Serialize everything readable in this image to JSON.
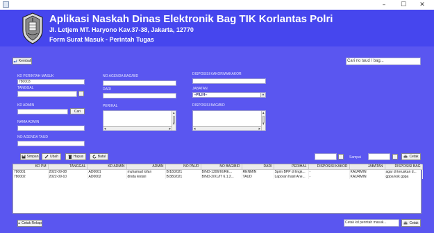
{
  "window": {
    "minimize": "–",
    "maximize": "☐",
    "close": "✕"
  },
  "header": {
    "title": "Aplikasi Naskah Dinas Elektronik Bag TIK Korlantas Polri",
    "address": "Jl. Letjem MT. Haryono Kav.37-38, Jakarta, 12770",
    "form_title": "Form Surat Masuk - Perintah Tugas"
  },
  "toolbar_top": {
    "back_label": "Kembali",
    "search_placeholder": "Cari no taud / bag..."
  },
  "form": {
    "kd_perintah_label": "KD PERINTAH MASUK",
    "kd_perintah_value": "780003",
    "tanggal_label": "TANGGAL",
    "kd_admin_label": "KD ADMIN",
    "cari_label": "Cari",
    "nama_admin_label": "NAMA ADMIN",
    "no_agenda_taud_label": "NO AGENDA TAUD",
    "no_agenda_bag_label": "NO AGENDA BAG/BID",
    "dari_label": "DARI",
    "perihal_label": "PERIHAL",
    "disposisi_kakor_label": "DISPOSISI KAKOR/WAKAKOR",
    "jabatan_label": "JABATAN",
    "jabatan_value": "--PILIH--",
    "disposisi_bag_label": "DISPOSISI BAG/BID"
  },
  "actions": {
    "simpan": "Simpan",
    "ubah": "Ubah",
    "hapus": "Hapus",
    "batal": "Batal",
    "sampai": "Sampai",
    "cetak": "Cetak"
  },
  "table": {
    "columns": [
      "KD PM",
      "TANGGAL",
      "KD ADMIN",
      "ADMIN",
      "NO PAUD",
      "NO BAG/BID",
      "DARI",
      "PERIHAL",
      "DISPOSISI KAKOR",
      "JABATAN",
      "DISPOSISI BAG"
    ],
    "rows": [
      [
        "780001",
        "2022-09-08",
        "AD0001",
        "muhamad tofan",
        "B/18/2021",
        "B/ND-1306/IX/RE...",
        "RENMIN",
        "Sprin BPP di lingk...",
        "-",
        "KAURMIN",
        "agar di teruskan d..."
      ],
      [
        "780002",
        "2022-09-10",
        "AD0002",
        "dinda lestari",
        "B/38/2021",
        "B/ND-2/XL/IT 6.1.2...",
        "TAUD",
        "Laporan hasil Ane...",
        "-",
        "KAURMIN",
        "gppa kok gppa"
      ]
    ]
  },
  "bottom": {
    "cetak_rekap": "Cetak Rekap",
    "print_placeholder": "Cetak kd perintah masuk...",
    "cetak": "Cetak"
  },
  "colors": {
    "header_bg": "#4646ee",
    "panel_bg": "#5a56f0"
  }
}
